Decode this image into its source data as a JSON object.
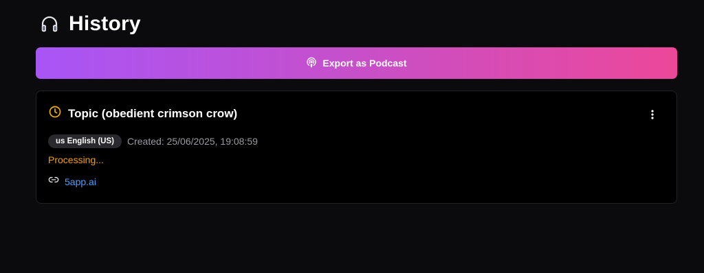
{
  "header": {
    "title": "History",
    "icon": "headphones-icon"
  },
  "export_button": {
    "label": "Export as Podcast",
    "icon": "podcast-icon",
    "gradient_start": "#a855f7",
    "gradient_end": "#ec4899"
  },
  "items": [
    {
      "title": "Topic (obedient crimson crow)",
      "status_icon": "clock-icon",
      "language_badge": "us English (US)",
      "created": "Created: 25/06/2025, 19:08:59",
      "status": "Processing...",
      "status_color": "#f59e0b",
      "link_icon": "link-icon",
      "link_text": "5app.ai",
      "menu_icon": "more-vertical-icon"
    }
  ]
}
